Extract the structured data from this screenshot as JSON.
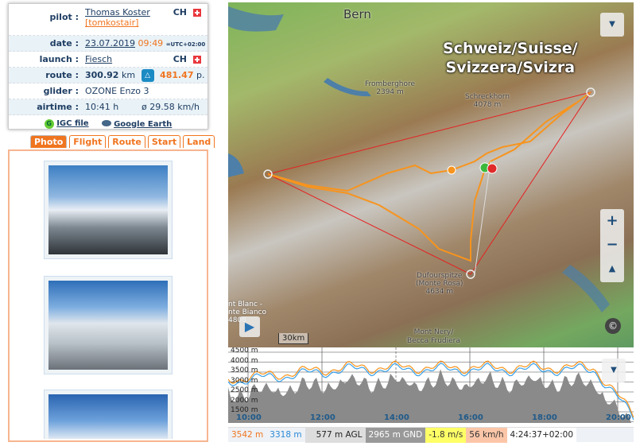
{
  "flight": {
    "pilot_label": "pilot :",
    "pilot_name": "Thomas Koster",
    "pilot_user": "[tomkostair]",
    "pilot_country": "CH",
    "date_label": "date :",
    "date": "23.07.2019",
    "time": "09:49",
    "tz": "=UTC+02:00",
    "launch_label": "launch :",
    "launch": "Fiesch",
    "launch_country": "CH",
    "route_label": "route :",
    "route_km": "300.92",
    "route_unit": "km",
    "points": "481.47",
    "points_unit": "p.",
    "glider_label": "glider :",
    "glider": "OZONE Enzo 3",
    "airtime_label": "airtime :",
    "airtime": "10:41 h",
    "avg_speed": "ø 29.58 km/h",
    "igc_link": "IGC file",
    "ge_link": "Google Earth"
  },
  "tabs": [
    {
      "label": "Photo",
      "active": true
    },
    {
      "label": "Flight"
    },
    {
      "label": "Route"
    },
    {
      "label": "Start"
    },
    {
      "label": "Land"
    }
  ],
  "map": {
    "labels": {
      "bern": "Bern",
      "country1": "Schweiz/Suisse/",
      "country2": "Svizzera/Svizra",
      "peak1": "Fromberghore",
      "peak1_h": "2394 m",
      "peak2": "Schreckhorn",
      "peak2_h": "4078 m",
      "peak3a": "Dufourspitze",
      "peak3b": "(Monte Rosa)",
      "peak3_h": "4634 m",
      "peak4a": "nt Blanc -",
      "peak4b": "nte Bianco",
      "peak4_h": "4808",
      "peak5a": "Mont Nery/",
      "peak5b": "Becca Frudiera",
      "scale": "30km"
    },
    "zoom_in": "+",
    "zoom_out": "−",
    "copyright": "©"
  },
  "chart": {
    "y_ticks": [
      "4500 m",
      "4000 m",
      "3500 m",
      "3000 m",
      "2500 m",
      "2000 m",
      "1500 m"
    ],
    "x_ticks": [
      "10:00",
      "12:00",
      "14:00",
      "16:00",
      "18:00",
      "20:00"
    ]
  },
  "status": {
    "alt_gps": "3542 m",
    "alt_baro": "3318 m",
    "agl": "577 m AGL",
    "gnd": "2965 m GND",
    "vario": "-1.8 m/s",
    "speed": "56 km/h",
    "time": "4:24:37+02:00"
  },
  "colors": {
    "accent": "#f07520",
    "track": "#f7941d",
    "baro": "#3aa0e8",
    "route": "#e52020"
  }
}
